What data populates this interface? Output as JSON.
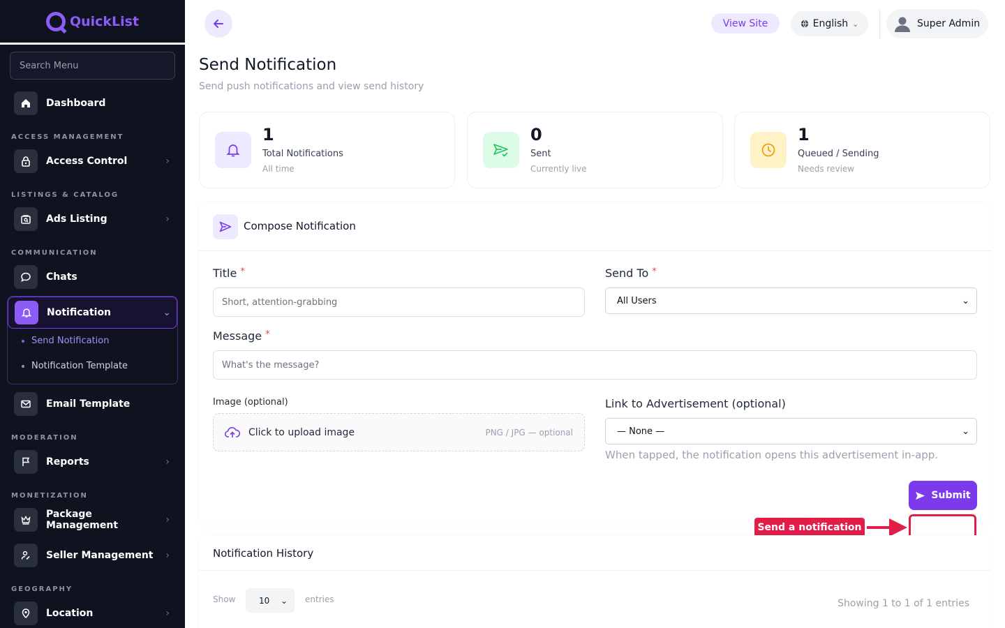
{
  "brand": {
    "name": "QuickList"
  },
  "sidebar": {
    "search_placeholder": "Search Menu",
    "sections": {
      "access": "ACCESS MANAGEMENT",
      "listings": "LISTINGS & CATALOG",
      "communication": "COMMUNICATION",
      "moderation": "MODERATION",
      "monetization": "MONETIZATION",
      "geography": "GEOGRAPHY"
    },
    "items": {
      "dashboard": "Dashboard",
      "access_control": "Access Control",
      "ads_listing": "Ads Listing",
      "chats": "Chats",
      "notification": "Notification",
      "send_notification": "Send Notification",
      "notification_template": "Notification Template",
      "email_template": "Email Template",
      "reports": "Reports",
      "package_management": "Package Management",
      "seller_management": "Seller Management",
      "location": "Location"
    }
  },
  "topbar": {
    "view_site": "View Site",
    "language": "English",
    "user": "Super Admin"
  },
  "page": {
    "title": "Send Notification",
    "subtitle": "Send push notifications and view send history"
  },
  "stats": [
    {
      "value": "1",
      "label": "Total Notifications",
      "note": "All time"
    },
    {
      "value": "0",
      "label": "Sent",
      "note": "Currently live"
    },
    {
      "value": "1",
      "label": "Queued / Sending",
      "note": "Needs review"
    }
  ],
  "compose": {
    "title": "Compose Notification",
    "title_label": "Title",
    "title_placeholder": "Short, attention-grabbing",
    "send_to_label": "Send To",
    "send_to_value": "All Users",
    "message_label": "Message",
    "message_placeholder": "What's the message?",
    "image_label": "Image (optional)",
    "upload_text": "Click to upload image",
    "upload_hint": "PNG / JPG — optional",
    "link_label": "Link to Advertisement (optional)",
    "link_value": "— None —",
    "link_help": "When tapped, the notification opens this advertisement in-app.",
    "submit": "Submit",
    "required_mark": "*"
  },
  "annotation": {
    "label": "Send a notification"
  },
  "history": {
    "title": "Notification History",
    "show": "Show",
    "entries_value": "10",
    "entries": "entries",
    "showing": "Showing 1 to 1 of 1 entries"
  },
  "colors": {
    "accent": "#7c3aed",
    "sidebar_bg": "#0f1320",
    "annotation": "#e11d48",
    "sent_green": "#22c55e",
    "queued_orange": "#f59e0b"
  }
}
